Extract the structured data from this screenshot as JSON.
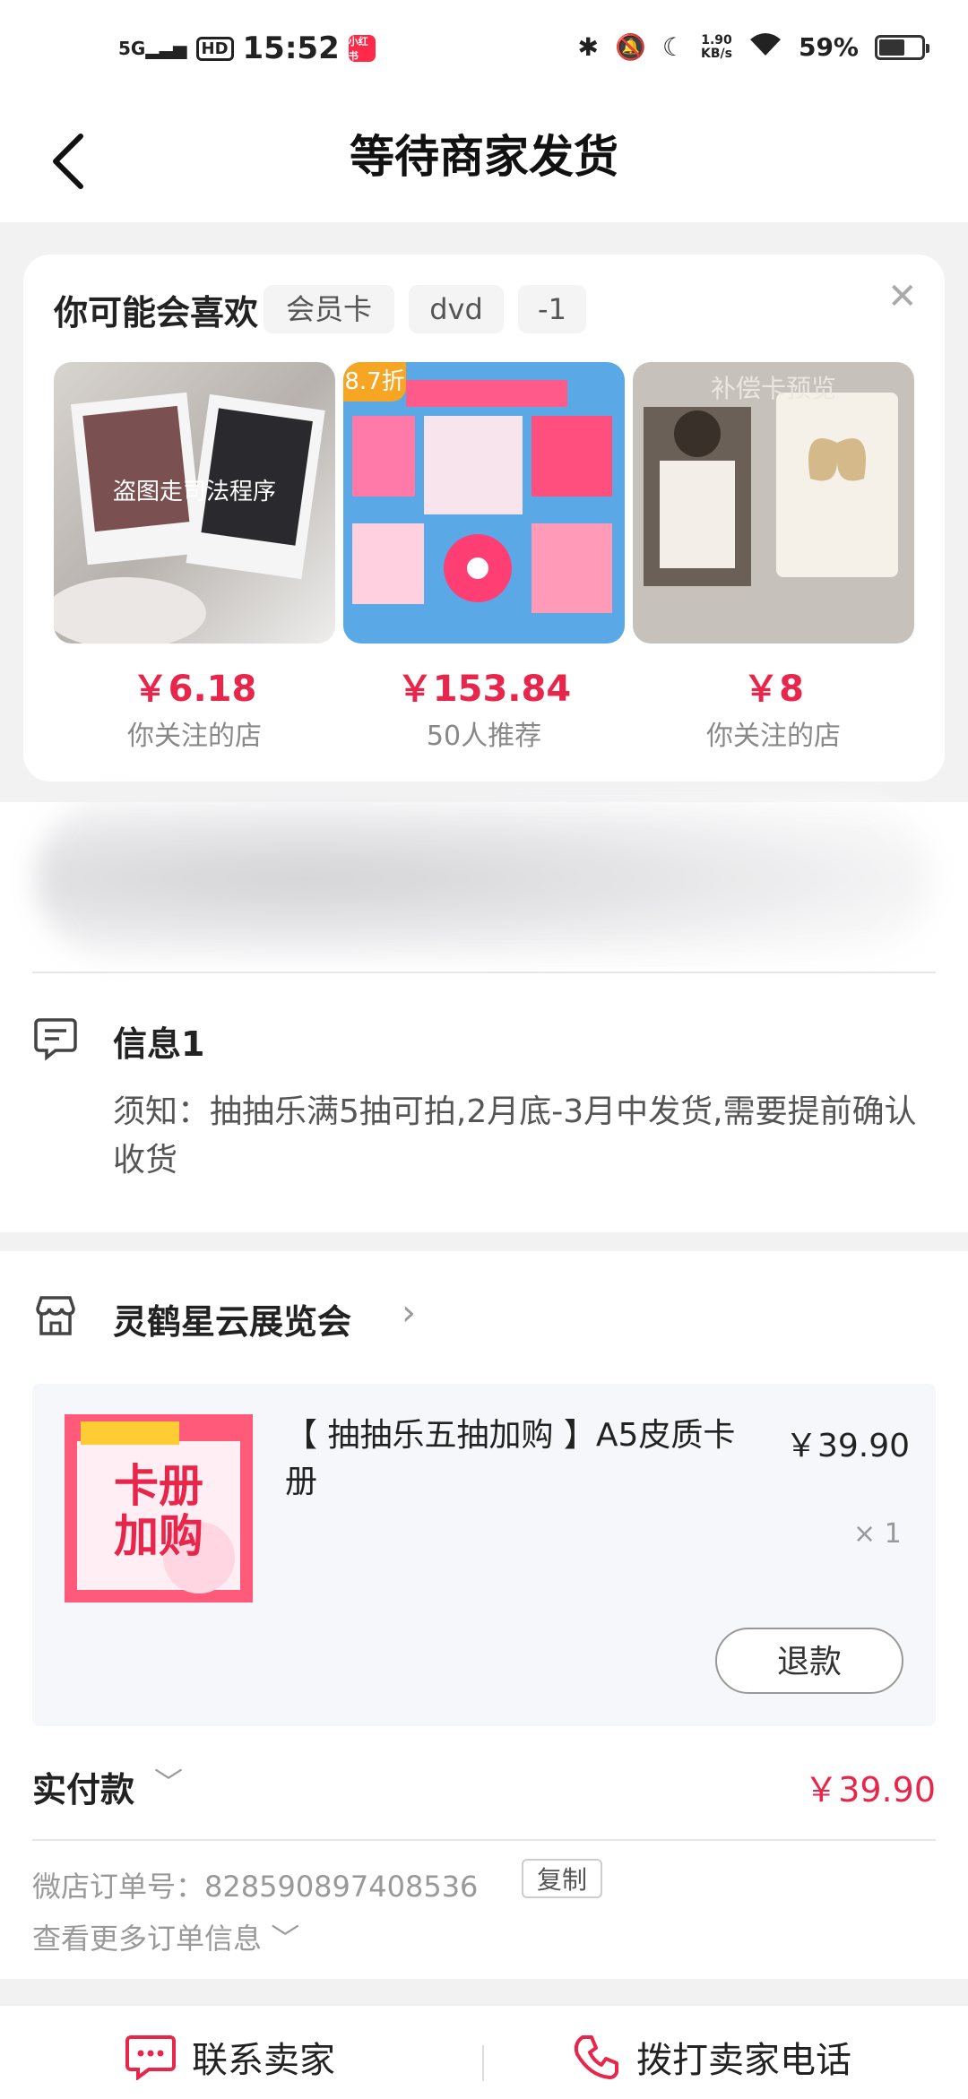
{
  "status_bar": {
    "network": "5G",
    "hd": "HD",
    "time": "15:52",
    "app_badge": "小红书",
    "net_speed": "1.90",
    "net_unit": "KB/s",
    "battery": "59%"
  },
  "nav": {
    "title": "等待商家发货"
  },
  "recommend": {
    "title": "你可能会喜欢",
    "tags": [
      "会员卡",
      "dvd",
      "-1"
    ],
    "items": [
      {
        "price": "￥6.18",
        "sub": "你关注的店",
        "overlay": "盗图走司法程序"
      },
      {
        "price": "￥153.84",
        "sub": "50人推荐",
        "discount": "8.7折"
      },
      {
        "price": "￥8",
        "sub": "你关注的店",
        "overlay": "补偿卡预览"
      }
    ]
  },
  "info": {
    "title": "信息1",
    "body": "须知：抽抽乐满5抽可拍,2月底-3月中发货,需要提前确认收货"
  },
  "store": {
    "name": "灵鹤星云展览会"
  },
  "product": {
    "title": "【 抽抽乐五抽加购 】A5皮质卡册",
    "price": "￥39.90",
    "qty": "× 1",
    "image_text_1": "卡册",
    "image_text_2": "加购",
    "refund_label": "退款"
  },
  "payment": {
    "label": "实付款",
    "amount": "￥39.90",
    "order_label": "微店订单号：",
    "order_number": "828590897408536",
    "copy_label": "复制",
    "more_label": "查看更多订单信息"
  },
  "bottom": {
    "contact_label": "联系卖家",
    "call_label": "拨打卖家电话"
  },
  "colors": {
    "accent": "#e8254a"
  }
}
